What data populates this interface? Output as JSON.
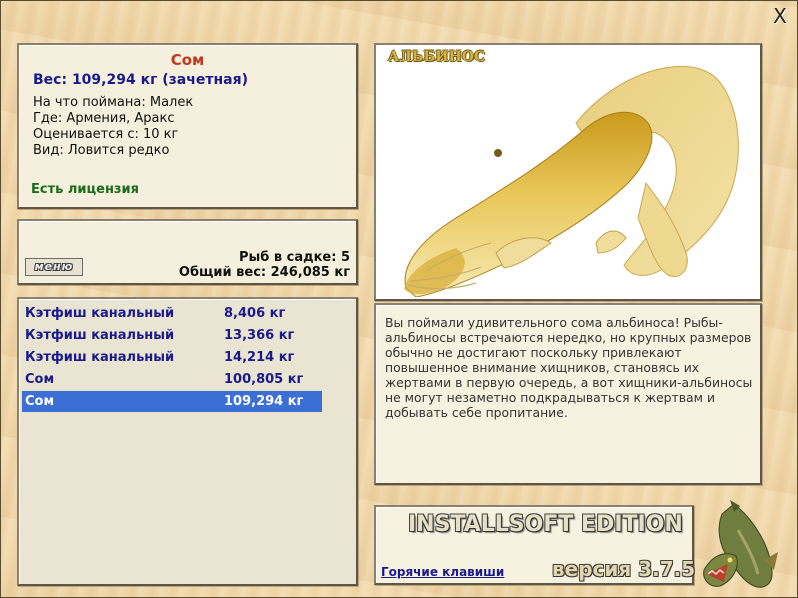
{
  "window": {
    "close_glyph": "X"
  },
  "fish_info": {
    "name": "Сом",
    "weight_line": "Вес: 109,294 кг (зачетная)",
    "caught_on": "На что поймана: Малек",
    "location": "Где: Армения, Аракс",
    "valued_from": "Оценивается с: 10 кг",
    "rarity": "Вид: Ловится редко",
    "license": "Есть лицензия"
  },
  "keepnet": {
    "menu_label": "меню",
    "fish_count": "Рыб в садке: 5",
    "total_weight": "Общий вес: 246,085 кг"
  },
  "catch_list": [
    {
      "name": "Кэтфиш канальный",
      "weight": "8,406 кг",
      "selected": false
    },
    {
      "name": "Кэтфиш канальный",
      "weight": "13,366 кг",
      "selected": false
    },
    {
      "name": "Кэтфиш канальный",
      "weight": "14,214 кг",
      "selected": false
    },
    {
      "name": "Сом",
      "weight": "100,805 кг",
      "selected": false
    },
    {
      "name": "Сом",
      "weight": "109,294 кг",
      "selected": true
    }
  ],
  "picture": {
    "label": "АЛЬБИНОС"
  },
  "description": "Вы поймали удивительного сома альбиноса! Рыбы-альбиносы встречаются нередко, но крупных размеров обычно не достигают поскольку привлекают повышенное внимание хищников, становясь их жертвами в первую очередь, а вот хищники-альбиносы не могут незаметно подкрадываться к жертвам и добывать себе пропитание.",
  "brand": {
    "edition": "INSTALLSOFT EDITION",
    "hotkeys": "Горячие клавиши",
    "version": "версия 3.7.5"
  },
  "colors": {
    "title_red": "#c0391b",
    "link_blue": "#1a1a8c",
    "license_green": "#1b6b1b",
    "selection": "#3b6fd6",
    "wood": "#f1d9ac"
  }
}
